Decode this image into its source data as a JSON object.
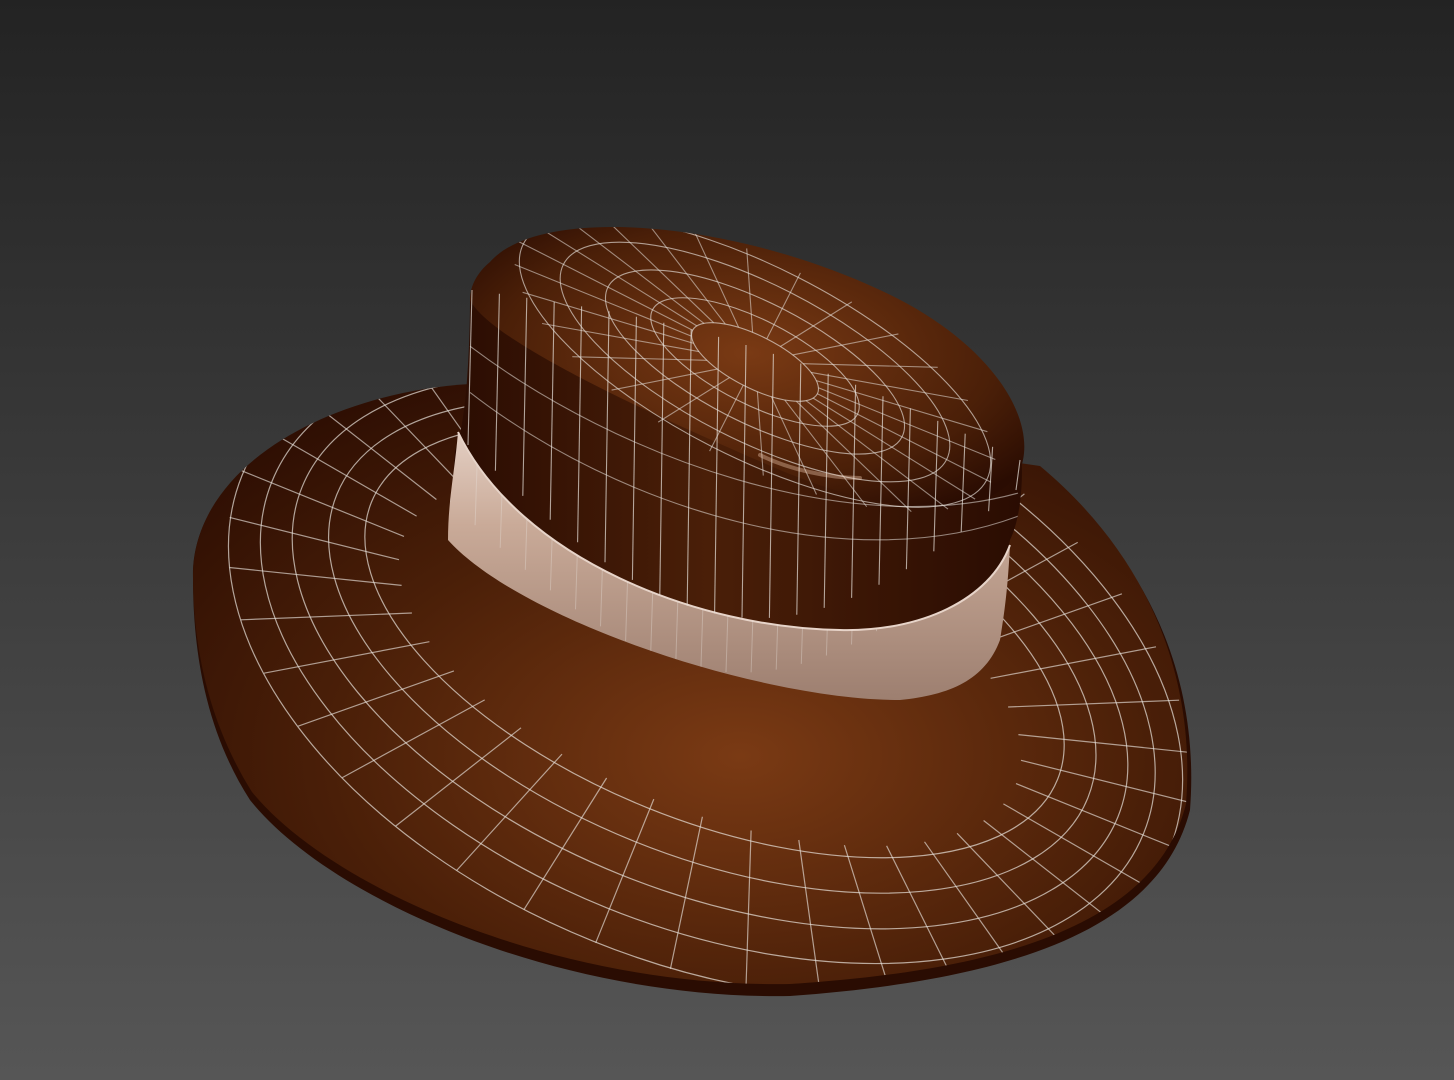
{
  "viewport": {
    "object": "hat-model",
    "display_mode": "shaded-with-wireframe",
    "colors": {
      "background_top": "#232323",
      "background_bottom": "#565656",
      "hat_base": "#4a1f08",
      "hat_dark": "#2a0c02",
      "hat_light": "#7a3a14",
      "band": "#c9aa98",
      "band_dark": "#9d7f70",
      "band_light": "#e4cfc3",
      "wire": "#e8e2dc"
    }
  }
}
